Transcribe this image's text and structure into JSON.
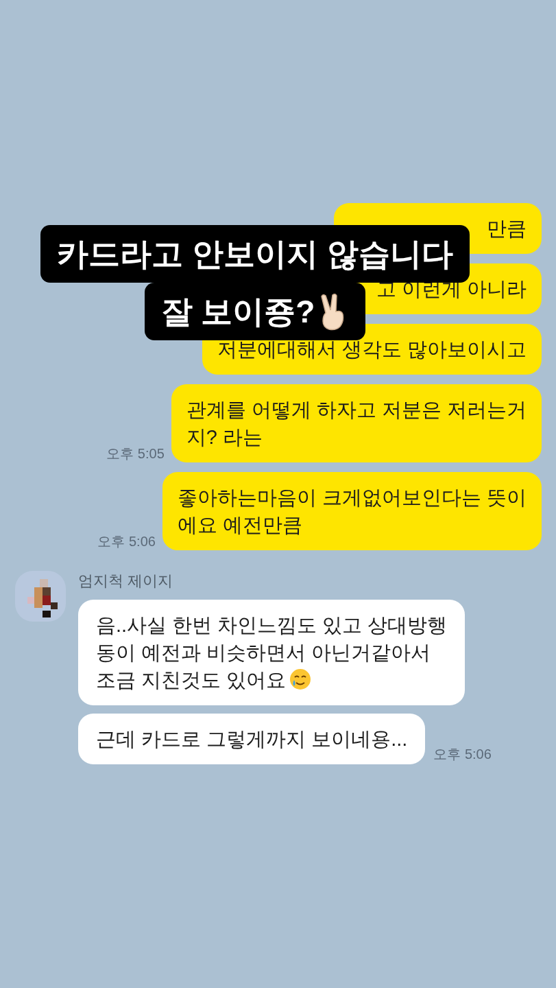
{
  "caption": {
    "lines": [
      "카드라고 안보이지 않습니다",
      "잘 보이죵?"
    ]
  },
  "sent": [
    {
      "lines": [
        "만큼"
      ],
      "partially_covered": true
    },
    {
      "lines": [
        "고 이런게 아니라"
      ],
      "partially_covered": true
    },
    {
      "lines": [
        "저분에대해서 생각도 많아보이시고"
      ],
      "partially_covered": false
    },
    {
      "lines": [
        "관계를 어떻게 하자고 저분은 저러는거",
        "지? 라는"
      ],
      "partially_covered": false,
      "time": "오후 5:05"
    },
    {
      "lines": [
        "좋아하는마음이 크게없어보인다는 뜻이",
        "에요 예전만큼"
      ],
      "partially_covered": false,
      "time": "오후 5:06"
    }
  ],
  "received": {
    "sender": "엄지척 제이지",
    "messages": [
      {
        "lines": [
          "음..사실 한번 차인느낌도 있고 상대방행",
          "동이 예전과 비슷하면서 아닌거같아서",
          "조금 지친것도 있어요"
        ],
        "emoji": true
      },
      {
        "lines": [
          "근데 카드로 그렇게까지 보이네용..."
        ],
        "emoji": false,
        "time": "오후 5:06"
      }
    ]
  }
}
